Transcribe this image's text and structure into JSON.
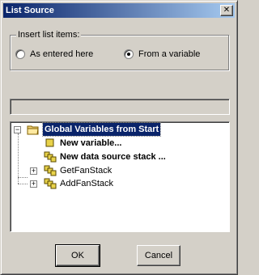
{
  "window": {
    "title": "List Source"
  },
  "insert_group": {
    "label": "Insert list items:",
    "options": [
      {
        "label": "As entered here",
        "selected": false
      },
      {
        "label": "From a variable",
        "selected": true
      }
    ]
  },
  "path_field": {
    "value": ""
  },
  "tree": {
    "root": {
      "label": "Global Variables from Start",
      "expanded": true,
      "selected": true
    },
    "items": [
      {
        "label": "New variable...",
        "bold": true,
        "icon": "variable-icon"
      },
      {
        "label": "New data source stack ...",
        "bold": true,
        "icon": "stack-icon"
      },
      {
        "label": "GetFanStack",
        "bold": false,
        "icon": "stack-icon",
        "collapsed": true
      },
      {
        "label": "AddFanStack",
        "bold": false,
        "icon": "stack-icon",
        "collapsed": true
      }
    ]
  },
  "buttons": {
    "ok": "OK",
    "cancel": "Cancel"
  },
  "colors": {
    "selection": "#0a246a",
    "titlebar_start": "#0a246a",
    "titlebar_end": "#a6caf0"
  }
}
